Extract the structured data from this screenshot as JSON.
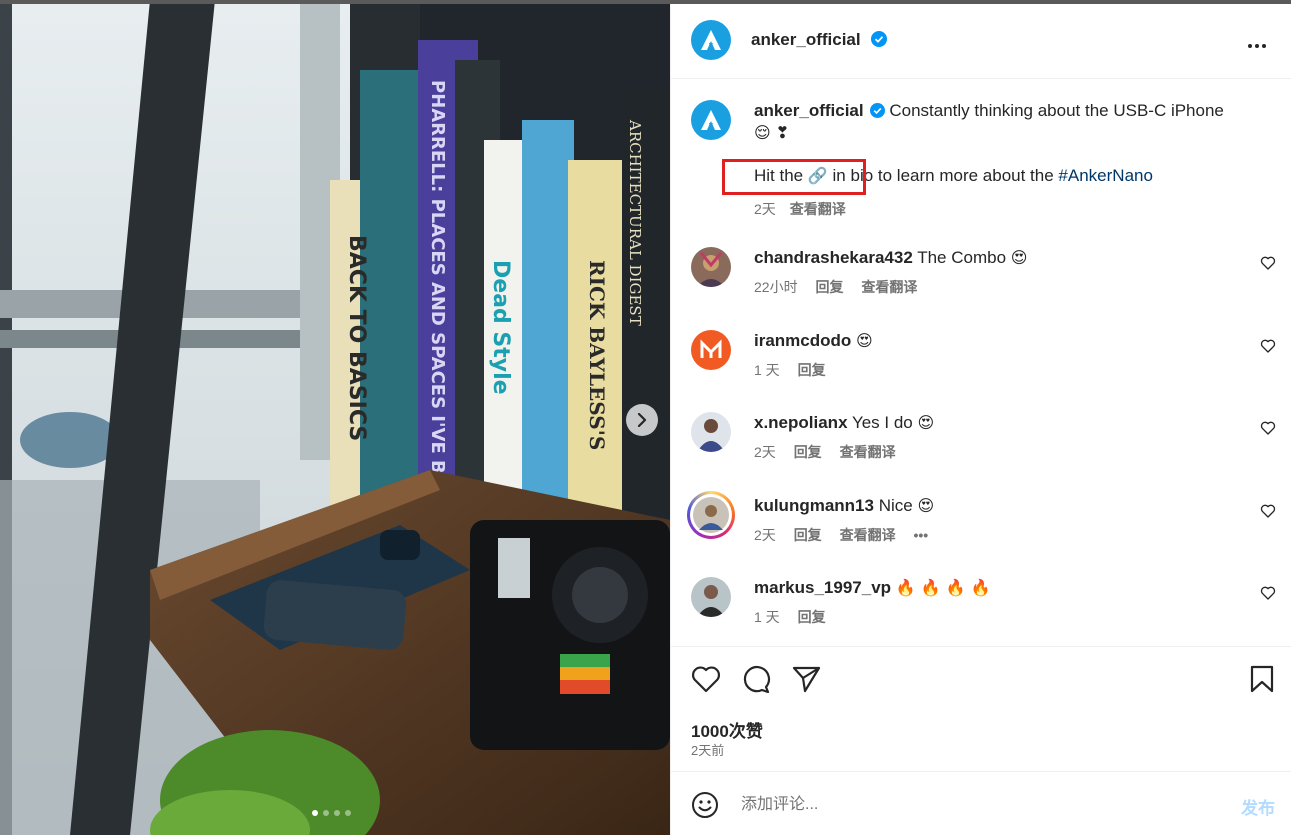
{
  "author": {
    "username": "anker_official",
    "verified": true
  },
  "caption": {
    "username": "anker_official",
    "text": "Constantly thinking about the USB-C iPhone",
    "emojis": "😌 ❣",
    "line2_before": "Hit the",
    "line2_link_icon": "🔗",
    "line2_in_bio": "in bio",
    "line2_after": "to learn more about the",
    "hashtag": "#AnkerNano",
    "age": "2天",
    "translate": "查看翻译"
  },
  "comments": [
    {
      "username": "chandrashekara432",
      "text": "The Combo",
      "emoji": "😍",
      "age": "22小时",
      "reply": "回复",
      "translate": "查看翻译",
      "avatar_color": "#8a6a5a"
    },
    {
      "username": "iranmcdodo",
      "text": "",
      "emoji": "😍",
      "age": "1 天",
      "reply": "回复",
      "translate": "",
      "avatar_color": "#f15a22"
    },
    {
      "username": "x.nepolianx",
      "text": "Yes I do",
      "emoji": "😍",
      "age": "2天",
      "reply": "回复",
      "translate": "查看翻译",
      "avatar_color": "#3a4a6a"
    },
    {
      "username": "kulungmann13",
      "text": "Nice",
      "emoji": "😍",
      "age": "2天",
      "reply": "回复",
      "translate": "查看翻译",
      "more": "•••",
      "avatar_color": "#c9c2b8"
    },
    {
      "username": "markus_1997_vp",
      "text": "",
      "emoji": "🔥 🔥 🔥 🔥",
      "age": "1 天",
      "reply": "回复",
      "translate": "",
      "avatar_color": "#7a8a8a"
    }
  ],
  "stats": {
    "likes": "1000次赞",
    "posted": "2天前"
  },
  "composer": {
    "placeholder": "添加评论...",
    "post_label": "发布"
  },
  "carousel": {
    "total": 4,
    "current": 1
  },
  "colors": {
    "brand": "#1aa0e0",
    "verified": "#0095f6",
    "highlight": "#e02020"
  }
}
